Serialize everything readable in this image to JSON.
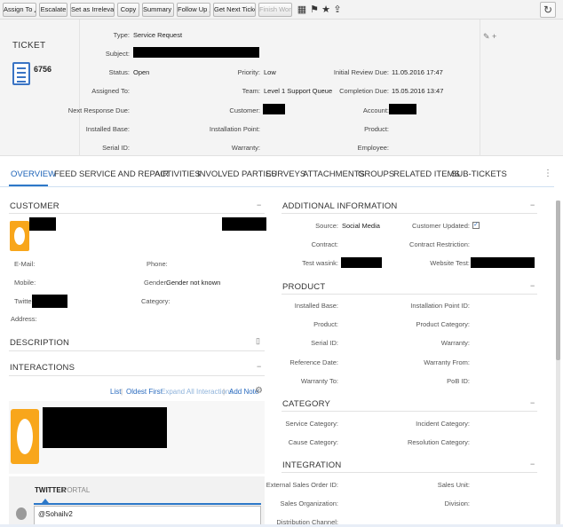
{
  "toolbar": {
    "assign_to": "Assign To",
    "escalate": "Escalate",
    "set_irrelevant": "Set as Irrelevant",
    "copy": "Copy",
    "summary": "Summary",
    "follow_up": "Follow Up",
    "get_next_ticket": "Get Next Ticket",
    "finish_work": "Finish Work",
    "refresh": "↻"
  },
  "ticket": {
    "label": "TICKET",
    "number": "6756",
    "fields": {
      "type_label": "Type:",
      "type_value": "Service Request",
      "subject_label": "Subject:",
      "status_label": "Status:",
      "status_value": "Open",
      "priority_label": "Priority:",
      "priority_value": "Low",
      "initial_review_label": "Initial Review Due:",
      "initial_review_value": "11.05.2016 17:47",
      "assigned_to_label": "Assigned To:",
      "team_label": "Team:",
      "team_value": "Level 1 Support Queue",
      "completion_label": "Completion Due:",
      "completion_value": "15.05.2016 13:47",
      "next_response_label": "Next Response Due:",
      "customer_label": "Customer:",
      "account_label": "Account:",
      "installed_base_label": "Installed Base:",
      "installation_point_label": "Installation Point:",
      "product_label": "Product:",
      "serial_id_label": "Serial ID:",
      "warranty_label": "Warranty:",
      "employee_label": "Employee:"
    }
  },
  "tabs": [
    "OVERVIEW",
    "FEED",
    "SERVICE AND REPAIR",
    "ACTIVITIES",
    "INVOLVED PARTIES",
    "SURVEYS",
    "ATTACHMENTS",
    "GROUPS",
    "RELATED ITEMS",
    "SUB-TICKETS"
  ],
  "customer": {
    "title": "CUSTOMER",
    "email_label": "E-Mail:",
    "phone_label": "Phone:",
    "mobile_label": "Mobile:",
    "gender_label": "Gender:",
    "gender_value": "Gender not known",
    "twitter_label": "Twitter:",
    "category_label": "Category:",
    "address_label": "Address:"
  },
  "description": {
    "title": "DESCRIPTION"
  },
  "interactions": {
    "title": "INTERACTIONS",
    "list": "List",
    "oldest_first": "Oldest First",
    "expand_all": "Expand All Interactions",
    "add_note": "Add Note"
  },
  "reply": {
    "tab_twitter": "TWITTER",
    "tab_portal": "PORTAL",
    "input_value": "@Sohailv2"
  },
  "additional": {
    "title": "ADDITIONAL INFORMATION",
    "source_label": "Source:",
    "source_value": "Social Media",
    "customer_updated_label": "Customer Updated:",
    "contract_label": "Contract:",
    "contract_restriction_label": "Contract Restriction:",
    "test_wasink_label": "Test wasink:",
    "website_test_label": "Website Test:"
  },
  "product": {
    "title": "PRODUCT",
    "installed_base_label": "Installed Base:",
    "installation_point_id_label": "Installation Point ID:",
    "product_label": "Product:",
    "product_category_label": "Product Category:",
    "serial_id_label": "Serial ID:",
    "warranty_label": "Warranty:",
    "reference_date_label": "Reference Date:",
    "warranty_from_label": "Warranty From:",
    "warranty_to_label": "Warranty To:",
    "pob_id_label": "PoB ID:"
  },
  "category": {
    "title": "CATEGORY",
    "service_category_label": "Service Category:",
    "incident_category_label": "Incident Category:",
    "cause_category_label": "Cause Category:",
    "resolution_category_label": "Resolution Category:"
  },
  "integration": {
    "title": "INTEGRATION",
    "external_sales_order_label": "External Sales Order ID:",
    "sales_unit_label": "Sales Unit:",
    "sales_organization_label": "Sales Organization:",
    "division_label": "Division:",
    "distribution_channel_label": "Distribution Channel:"
  }
}
